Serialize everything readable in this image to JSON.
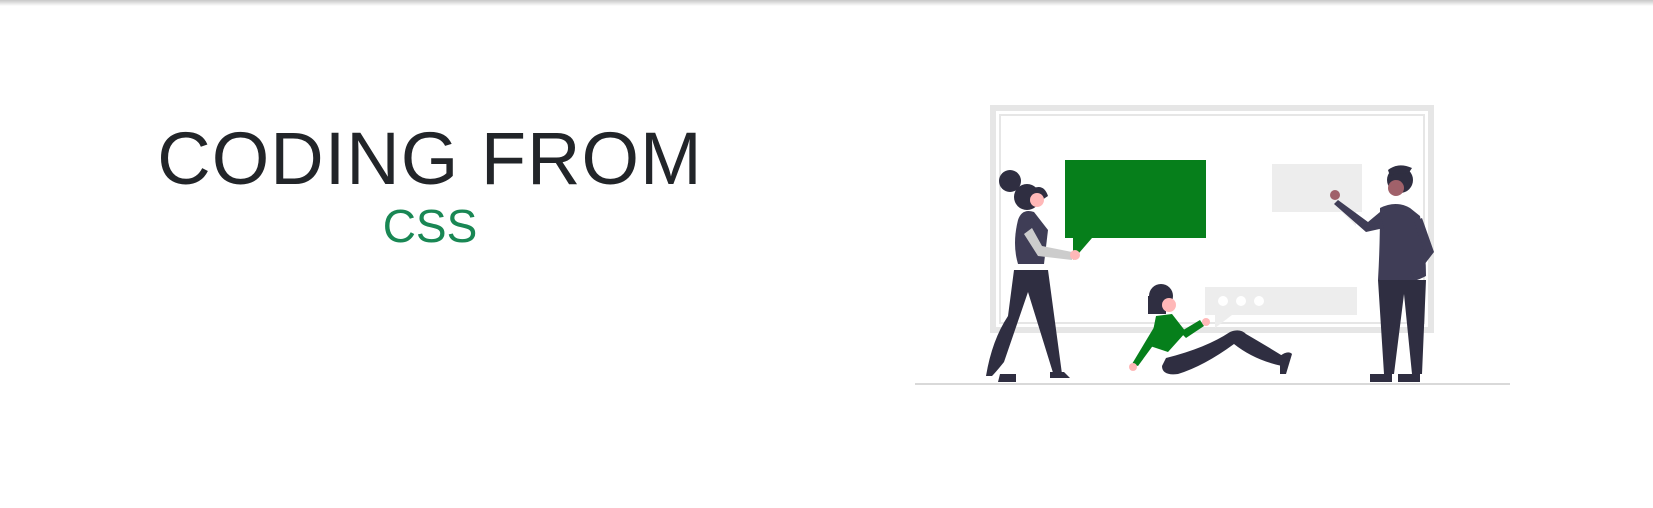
{
  "hero": {
    "title": "CODING FROM",
    "subtitle": "CSS"
  },
  "illustration": {
    "subject": "people-talking-at-whiteboard",
    "colors": {
      "accent": "#067f1b",
      "dark": "#2f2e41",
      "board": "#e6e6e6",
      "bubble_light": "#ededed",
      "skin": "#ffb8b8",
      "skin_dark": "#a0616a"
    }
  },
  "theme": {
    "title_color": "#222529",
    "subtitle_color": "#198754"
  }
}
